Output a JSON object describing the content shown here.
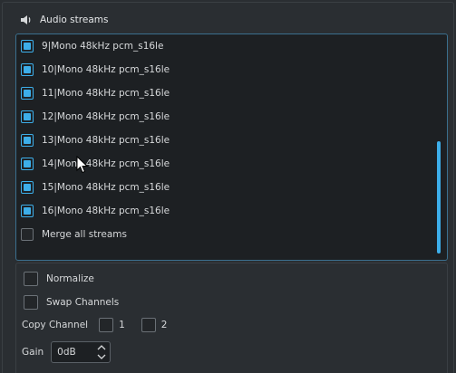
{
  "header": {
    "icon": "speaker-icon",
    "title": "Audio streams"
  },
  "streams": [
    {
      "label": "9|Mono 48kHz pcm_s16le",
      "checked": true
    },
    {
      "label": "10|Mono 48kHz pcm_s16le",
      "checked": true
    },
    {
      "label": "11|Mono 48kHz pcm_s16le",
      "checked": true
    },
    {
      "label": "12|Mono 48kHz pcm_s16le",
      "checked": true
    },
    {
      "label": "13|Mono 48kHz pcm_s16le",
      "checked": true
    },
    {
      "label": "14|Mono 48kHz pcm_s16le",
      "checked": true
    },
    {
      "label": "15|Mono 48kHz pcm_s16le",
      "checked": true
    },
    {
      "label": "16|Mono 48kHz pcm_s16le",
      "checked": true
    }
  ],
  "merge": {
    "label": "Merge all streams",
    "checked": false
  },
  "options": {
    "normalize": {
      "label": "Normalize",
      "checked": false
    },
    "swap": {
      "label": "Swap Channels",
      "checked": false
    },
    "copy_channel": {
      "label": "Copy Channel",
      "channel1": {
        "label": "1",
        "checked": false
      },
      "channel2": {
        "label": "2",
        "checked": false
      }
    },
    "gain": {
      "label": "Gain",
      "value": "0dB"
    }
  },
  "colors": {
    "accent": "#3daee9",
    "background": "#2a2e32",
    "panel": "#1d2023"
  }
}
